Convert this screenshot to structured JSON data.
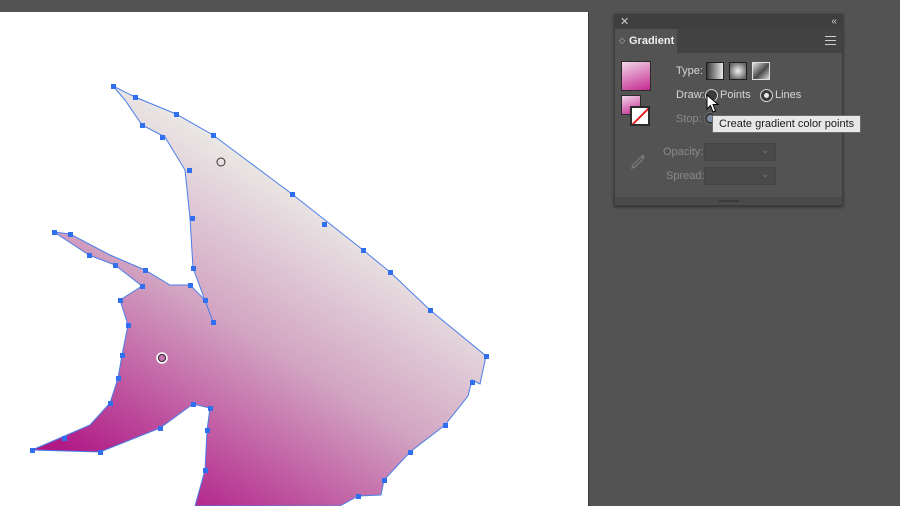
{
  "gradient_panel": {
    "close_glyph": "✕",
    "collapse_glyph": "‹‹",
    "tab_arrow_glyph": "◇",
    "tab_label": "Gradient",
    "type_label": "Type:",
    "draw_label": "Draw:",
    "draw_points_label": "Points",
    "draw_lines_label": "Lines",
    "stop_label": "Stop:",
    "tooltip": "Create gradient color points",
    "opacity_label": "Opacity:",
    "spread_label": "Spread:",
    "dropdown_glyph": "⌄",
    "selected_type": "freeform",
    "selected_draw": "Lines"
  },
  "canvas": {
    "gradient_colors": [
      "#f1fbef",
      "#d2a4c2",
      "#b01a86"
    ],
    "anchor_color": "#2f6ff0",
    "path_color": "#4a7ee8"
  }
}
